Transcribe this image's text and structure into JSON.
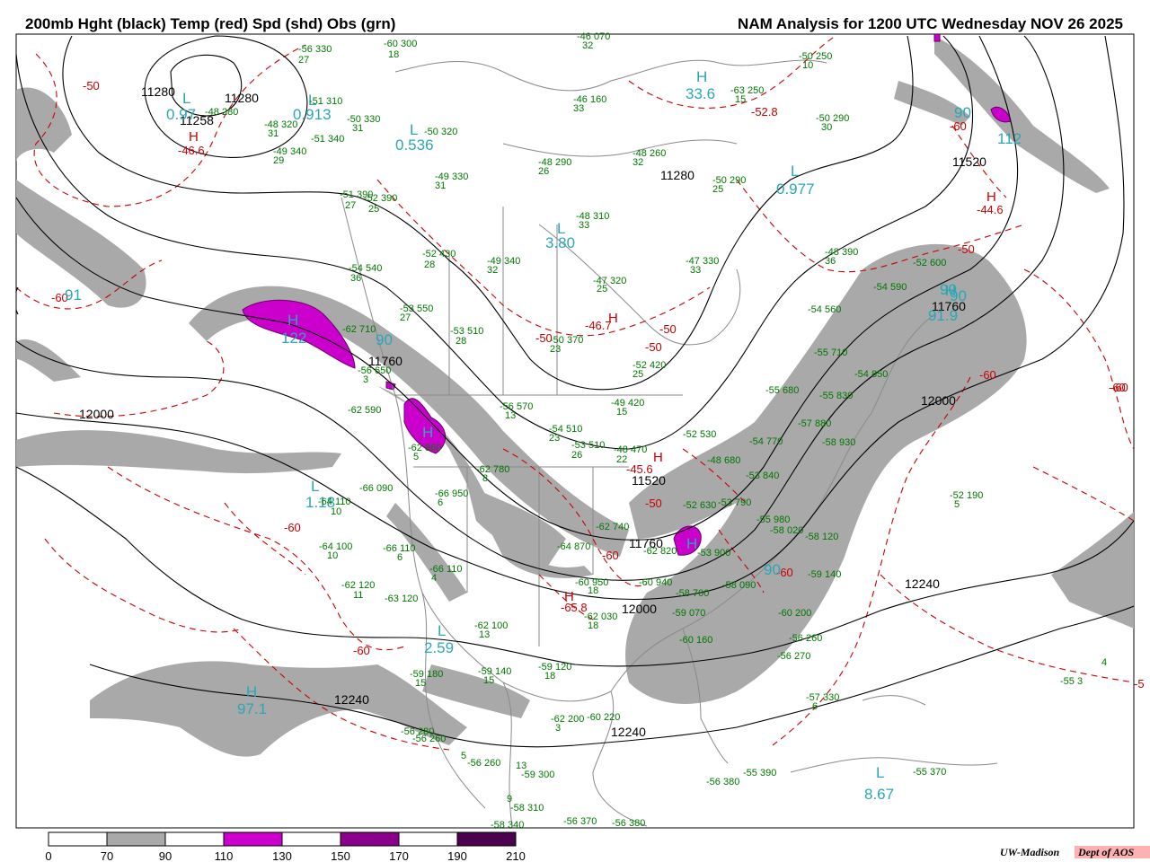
{
  "title": {
    "left": "200mb Hght (black) Temp (red) Spd (shd) Obs (grn)",
    "right": "NAM Analysis for 1200 UTC Wednesday  NOV 26 2025"
  },
  "credit": {
    "org": "UW-Madison",
    "dept": "Dept of AOS"
  },
  "colors": {
    "shade70": "#a9a9a9",
    "shade110": "#cc00cc",
    "shade150": "#8b008b",
    "shade190": "#4b0050",
    "height": "#000000",
    "temp": "#cc0000",
    "obs": "#007700",
    "spd_label": "#2aa7b8"
  },
  "colorbar": {
    "ticks": [
      "0",
      "70",
      "90",
      "110",
      "130",
      "150",
      "170",
      "190",
      "210"
    ],
    "bins": [
      "#ffffff",
      "#a9a9a9",
      "#ffffff",
      "#cc00cc",
      "#ffffff",
      "#8b008b",
      "#ffffff",
      "#4b0050"
    ]
  },
  "height_labels": [
    "11280",
    "11280",
    "11258",
    "11280",
    "11520",
    "11520",
    "11760",
    "11760",
    "11760",
    "12000",
    "12000",
    "12000",
    "12240",
    "12240",
    "12240"
  ],
  "temp_labels": [
    "-50",
    "-46.6",
    "-60",
    "-60",
    "-60",
    "-60",
    "-60",
    "-50",
    "-50",
    "-50",
    "-50",
    "-46.7",
    "-45.6",
    "-65.8",
    "-60",
    "-60",
    "-44.6",
    "-52.8",
    "-50",
    "-60",
    "-60",
    "-5"
  ],
  "temp_centers": [
    "H",
    "H",
    "H",
    "H",
    "H"
  ],
  "spd_labels": [
    "0.97",
    "0.913",
    "0.536",
    "3.80",
    "33.6",
    "0.977",
    "90",
    "112",
    "91.9",
    "90",
    "122",
    "90",
    "1.18",
    "2.59",
    "97.1",
    "90",
    "8.67",
    "91",
    "90"
  ],
  "spd_centers": [
    "L",
    "L",
    "L",
    "L",
    "H",
    "L",
    "H",
    "H",
    "H",
    "L",
    "L",
    "H",
    "L",
    "H"
  ],
  "obs": [
    "-56 330",
    "27",
    "-60 300",
    "18",
    "-46 070",
    "32",
    "-51 310",
    "-48 280",
    "-48 320",
    "31",
    "-50 330",
    "31",
    "-51 340",
    "-49 340",
    "29",
    "-50 320",
    "-49 330",
    "31",
    "-46 160",
    "33",
    "-48 290",
    "26",
    "-48 260",
    "32",
    "-50 290",
    "25",
    "-50 250",
    "10",
    "-63 250",
    "15",
    "-50 290",
    "30",
    "-51 390",
    "27",
    "-52 390",
    "25",
    "-48 310",
    "33",
    "-52 430",
    "28",
    "-49 340",
    "32",
    "-47 330",
    "33",
    "-48 390",
    "36",
    "-52 600",
    "-54 540",
    "36",
    "-53 550",
    "27",
    "-53 510",
    "28",
    "-54 590",
    "-54 560",
    "-47 320",
    "25",
    "-50 370",
    "23",
    "-55 710",
    "-55 830",
    "-54 850",
    "-52 420",
    "25",
    "-55 680",
    "-62 710",
    "-56 650",
    "3",
    "-62 590",
    "-62 860",
    "5",
    "-56 570",
    "13",
    "-54 510",
    "23",
    "-49 420",
    "15",
    "-53 510",
    "26",
    "-48 470",
    "22",
    "-57 880",
    "-58 930",
    "-54 770",
    "-48 680",
    "-62 780",
    "8",
    "-52 530",
    "-53 840",
    "-66 090",
    "-64 110",
    "10",
    "-66 950",
    "6",
    "-52 630",
    "-53 790",
    "-55 980",
    "-58 020",
    "-58 120",
    "-64 100",
    "10",
    "-66 110",
    "6",
    "-66 110",
    "4",
    "-64 870",
    "-62 740",
    "-62 820",
    "-53 900",
    "-59 140",
    "-62 120",
    "11",
    "-63 120",
    "-60 950",
    "18",
    "-60 940",
    "-58 700",
    "-58 090",
    "-60 200",
    "-62 030",
    "18",
    "-59 070",
    "-60 160",
    "-56 260",
    "-62 100",
    "13",
    "-56 270",
    "-59 180",
    "15",
    "-59 140",
    "15",
    "-59 120",
    "18",
    "-57 330",
    "6",
    "-52 190",
    "5",
    "-62 200",
    "3",
    "-60 220",
    "-56 280",
    "-56 260",
    "5",
    "-56 260",
    "13",
    "-59 300",
    "9",
    "-58 310",
    "-58 340",
    "-56 370",
    "-56 380",
    "-56 380",
    "-55 390",
    "-55 370",
    "-55 3",
    "4"
  ]
}
